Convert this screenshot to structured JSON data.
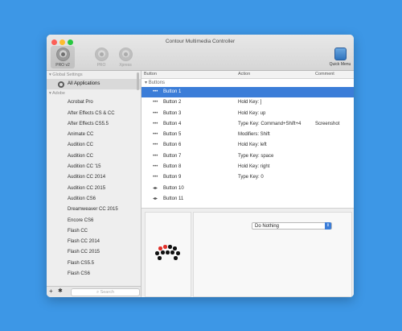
{
  "window": {
    "title": "Contour Multimedia Controller"
  },
  "devices": [
    {
      "label": "PRO v2",
      "icon": "shuttle-pro-v2-icon"
    },
    {
      "label": "PRO",
      "icon": "shuttle-pro-icon"
    },
    {
      "label": "Xpress",
      "icon": "shuttle-xpress-icon"
    }
  ],
  "quick_menu": {
    "label": "Quick Menu",
    "icon": "quick-menu-icon"
  },
  "sidebar": {
    "global_group": "Global Settings",
    "all_apps": "All Applications",
    "adobe_group": "Adobe",
    "apps": [
      "Acrobat Pro",
      "After Effects CS & CC",
      "After Effects CS5.5",
      "Animate CC",
      "Audition CC",
      "Audition CC",
      "Audition CC '15",
      "Audition CC 2014",
      "Audition CC 2015",
      "Audition CS6",
      "Dreamweaver CC 2015",
      "Encore CS6",
      "Flash CC",
      "Flash CC 2014",
      "Flash CC 2015",
      "Flash CS5.5",
      "Flash CS6"
    ],
    "add_button": "+",
    "settings_button": "✱",
    "search_placeholder": "Search"
  },
  "table": {
    "headers": {
      "button": "Button",
      "action": "Action",
      "comment": "Comment"
    },
    "group": "Buttons",
    "rows": [
      {
        "name": "Button 1",
        "action": "",
        "comment": ""
      },
      {
        "name": "Button 2",
        "action": "Hold Key: ]",
        "comment": ""
      },
      {
        "name": "Button 3",
        "action": "Hold Key: up",
        "comment": ""
      },
      {
        "name": "Button 4",
        "action": "Type Key: Command+Shift+4",
        "comment": "Screenshot"
      },
      {
        "name": "Button 5",
        "action": "Modifiers: Shift",
        "comment": ""
      },
      {
        "name": "Button 6",
        "action": "Hold Key: left",
        "comment": ""
      },
      {
        "name": "Button 7",
        "action": "Type Key: space",
        "comment": ""
      },
      {
        "name": "Button 8",
        "action": "Hold Key: right",
        "comment": ""
      },
      {
        "name": "Button 9",
        "action": "Type Key: 0",
        "comment": ""
      },
      {
        "name": "Button 10",
        "action": "",
        "comment": ""
      },
      {
        "name": "Button 11",
        "action": "",
        "comment": ""
      }
    ]
  },
  "detail": {
    "action_select": "Do Nothing"
  },
  "colors": {
    "background": "#3d97e6",
    "selection": "#3b7dd8",
    "highlight_dot": "#e0302a"
  }
}
